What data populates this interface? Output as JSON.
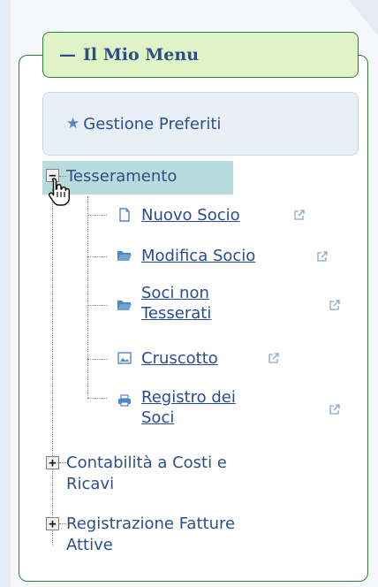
{
  "menu": {
    "title": "Il Mio Menu",
    "collapse_symbol": "—"
  },
  "favorites": {
    "label": "Gestione Preferiti",
    "icon": "star-icon"
  },
  "tree": {
    "tesseramento": {
      "label": "Tesseramento",
      "toggle": "−",
      "children": [
        {
          "label": "Nuovo Socio",
          "icon": "new-document-icon"
        },
        {
          "label": "Modifica Socio",
          "icon": "folder-open-icon"
        },
        {
          "label_line1": "Soci non",
          "label_line2": "Tesserati",
          "icon": "folder-open-icon"
        },
        {
          "label": "Cruscotto",
          "icon": "dashboard-image-icon"
        },
        {
          "label_line1": "Registro dei",
          "label_line2": "Soci",
          "icon": "printer-icon"
        }
      ]
    },
    "contabilita": {
      "label_line1": "Contabilità a Costi e",
      "label_line2": "Ricavi",
      "toggle": "+"
    },
    "fatture": {
      "label_line1": "Registrazione Fatture",
      "label_line2": "Attive",
      "toggle": "+"
    }
  },
  "colors": {
    "accent_green": "#2f7d3a",
    "legend_bg": "#dff3c6",
    "link_blue": "#2a4b8d",
    "selection_bg": "#b6dcdb"
  }
}
